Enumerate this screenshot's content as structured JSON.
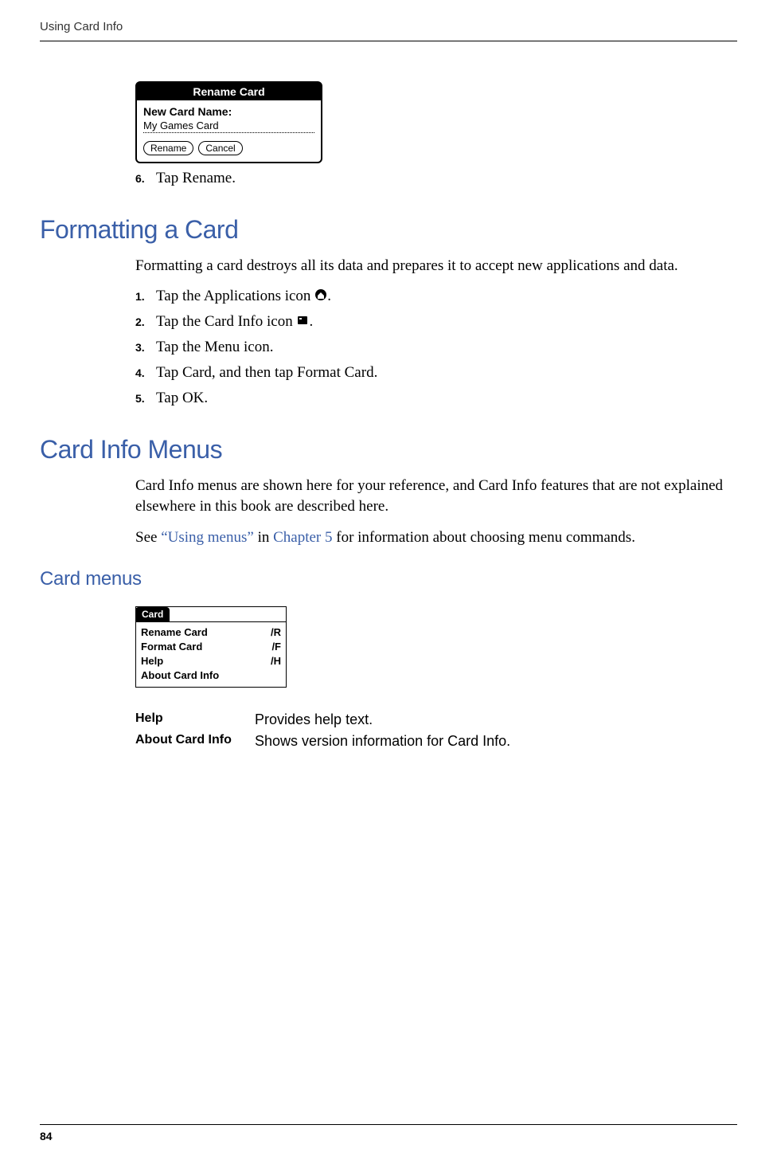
{
  "header": {
    "chapter_title": "Using Card Info"
  },
  "rename_dialog": {
    "title": "Rename Card",
    "label": "New Card Name:",
    "value": "My Games Card",
    "rename_btn": "Rename",
    "cancel_btn": "Cancel"
  },
  "step6": {
    "num": "6.",
    "text": "Tap Rename."
  },
  "formatting": {
    "heading": "Formatting a Card",
    "intro": "Formatting a card destroys all its data and prepares it to accept new applications and data.",
    "steps": [
      {
        "num": "1.",
        "text_pre": "Tap the Applications icon ",
        "icon": "home-icon",
        "text_post": "."
      },
      {
        "num": "2.",
        "text_pre": "Tap the Card Info icon ",
        "icon": "card-info-icon",
        "text_post": "."
      },
      {
        "num": "3.",
        "text_pre": "Tap the Menu icon.",
        "icon": "",
        "text_post": ""
      },
      {
        "num": "4.",
        "text_pre": "Tap Card, and then tap Format Card.",
        "icon": "",
        "text_post": ""
      },
      {
        "num": "5.",
        "text_pre": "Tap OK.",
        "icon": "",
        "text_post": ""
      }
    ]
  },
  "menus_section": {
    "heading": "Card Info Menus",
    "intro": "Card Info menus are shown here for your reference, and Card Info features that are not explained elsewhere in this book are described here.",
    "see_pre": "See ",
    "see_link1": "“Using menus”",
    "see_mid": " in ",
    "see_link2": "Chapter 5",
    "see_post": " for information about choosing menu commands."
  },
  "card_menus": {
    "heading": "Card menus",
    "tab": "Card",
    "items": [
      {
        "label": "Rename Card",
        "shortcut": "/R"
      },
      {
        "label": "Format Card",
        "shortcut": "/F"
      },
      {
        "label": "Help",
        "shortcut": "/H"
      },
      {
        "label": "About Card Info",
        "shortcut": ""
      }
    ]
  },
  "definitions": [
    {
      "term": "Help",
      "desc": "Provides help text."
    },
    {
      "term": "About Card Info",
      "desc": "Shows version information for Card Info."
    }
  ],
  "footer": {
    "page": "84"
  }
}
